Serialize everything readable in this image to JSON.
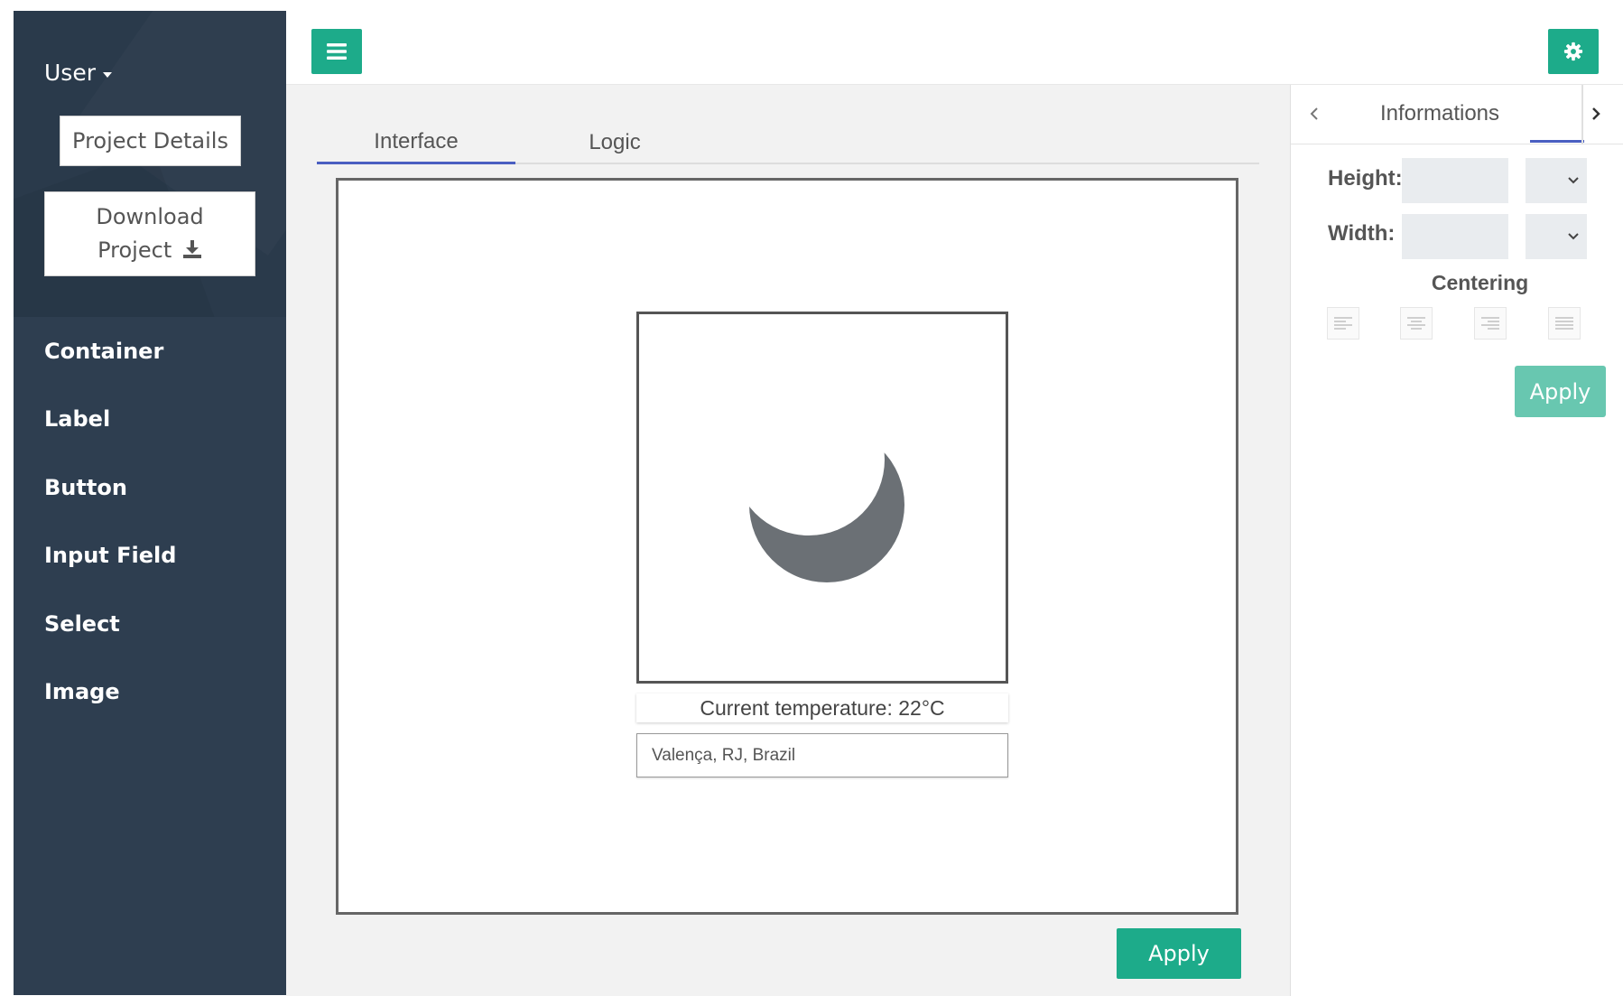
{
  "sidebar": {
    "user_label": "User",
    "project_details_label": "Project Details",
    "download_line1": "Download",
    "download_line2": "Project",
    "items": [
      {
        "label": "Container"
      },
      {
        "label": "Label"
      },
      {
        "label": "Button"
      },
      {
        "label": "Input Field"
      },
      {
        "label": "Select"
      },
      {
        "label": "Image"
      }
    ]
  },
  "toolbar": {
    "menu_icon": "hamburger-icon",
    "settings_icon": "gear-icon"
  },
  "main": {
    "tabs": [
      {
        "label": "Interface",
        "active": true
      },
      {
        "label": "Logic",
        "active": false
      }
    ],
    "preview": {
      "image_icon": "moon-icon",
      "temperature_text": "Current temperature: 22°C",
      "city_value": "Valença, RJ, Brazil"
    },
    "apply_label": "Apply"
  },
  "panel": {
    "title": "Informations",
    "height_label": "Height:",
    "width_label": "Width:",
    "centering_label": "Centering",
    "align_options": [
      "align-left-icon",
      "align-center-icon",
      "align-right-icon",
      "align-justify-icon"
    ],
    "apply_label": "Apply"
  },
  "colors": {
    "sidebar_bg": "#2e3e50",
    "accent_green": "#1dab8a",
    "accent_green_light": "#68c7b0",
    "tab_underline": "#4a5fc1",
    "moon_gray": "#6b7075"
  }
}
